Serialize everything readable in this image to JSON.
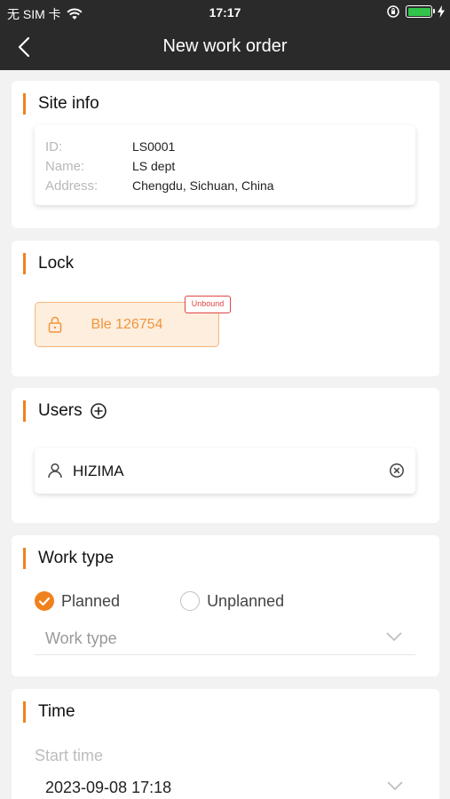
{
  "status_bar": {
    "carrier": "无 SIM 卡",
    "time": "17:17",
    "battery_color": "#32c34b"
  },
  "nav": {
    "title": "New work order",
    "back_icon": "chevron-left-icon"
  },
  "site_info": {
    "title": "Site info",
    "rows": [
      {
        "key": "ID:",
        "value": "LS0001"
      },
      {
        "key": "Name:",
        "value": "LS dept"
      },
      {
        "key": "Address:",
        "value": "Chengdu, Sichuan, China"
      }
    ]
  },
  "lock": {
    "title": "Lock",
    "name": "Ble 126754",
    "badge": "Unbound"
  },
  "users": {
    "title": "Users",
    "items": [
      {
        "name": "HIZIMA"
      }
    ]
  },
  "work_type": {
    "title": "Work type",
    "options": [
      "Planned",
      "Unplanned"
    ],
    "selected": "Planned",
    "placeholder": "Work type"
  },
  "time": {
    "title": "Time",
    "start_label": "Start time",
    "start_value": "2023-09-08 17:18"
  },
  "colors": {
    "accent": "#f0821e",
    "nav_bg": "#2a2a2a",
    "badge": "#e04545"
  }
}
